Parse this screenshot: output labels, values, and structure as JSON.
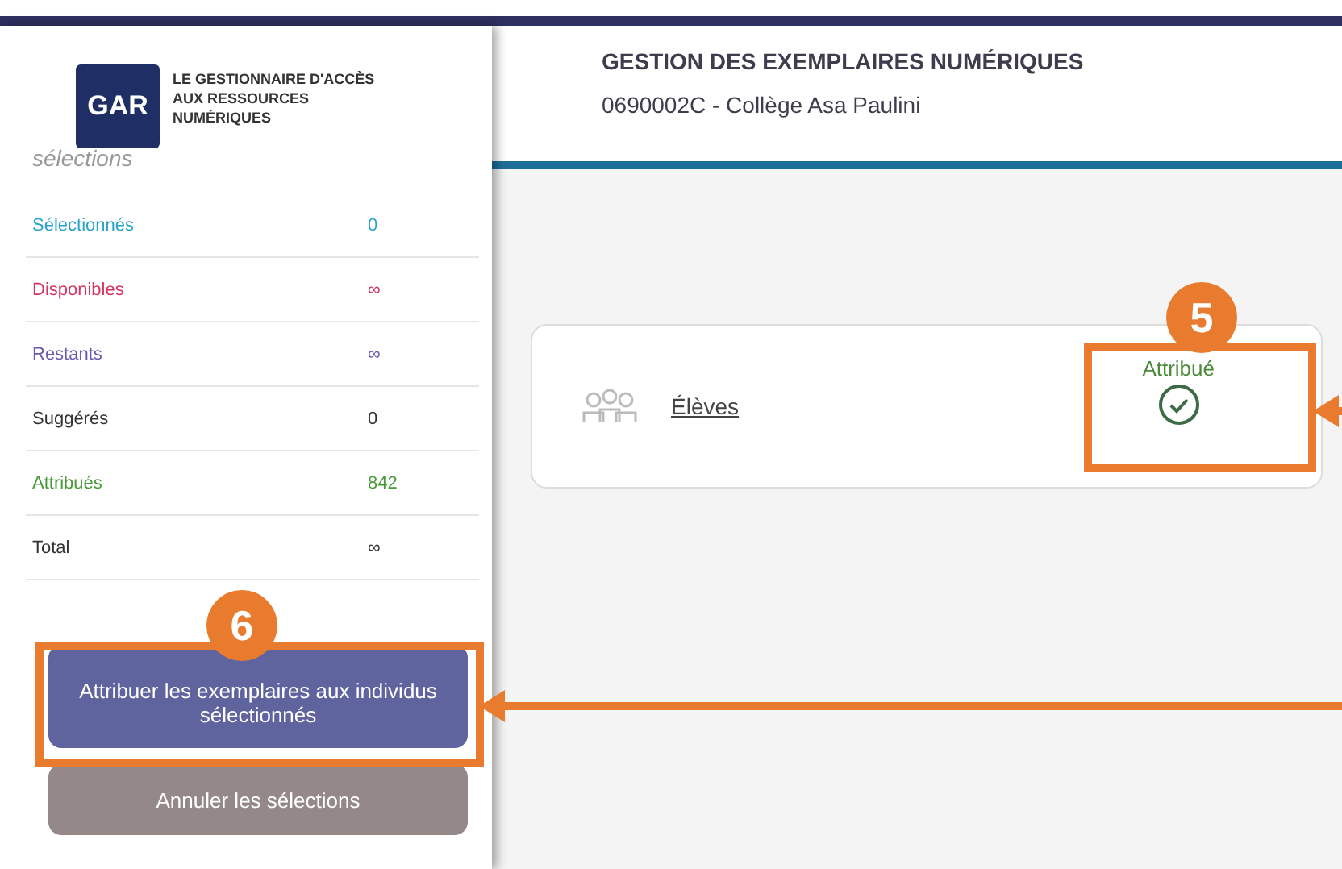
{
  "logo": {
    "mark": "GAR",
    "tagline": "LE GESTIONNAIRE D'ACCÈS AUX RESSOURCES NUMÉRIQUES"
  },
  "header": {
    "title": "GESTION DES EXEMPLAIRES NUMÉRIQUES",
    "subtitle": "0690002C - Collège Asa Paulini"
  },
  "sidebar": {
    "heading": "sélections",
    "stats": [
      {
        "label": "Sélectionnés",
        "value": "0",
        "color": "#2aa3c8"
      },
      {
        "label": "Disponibles",
        "value": "∞",
        "color": "#d6335e"
      },
      {
        "label": "Restants",
        "value": "∞",
        "color": "#6b5bb0"
      },
      {
        "label": "Suggérés",
        "value": "0",
        "color": "#333333"
      },
      {
        "label": "Attribués",
        "value": "842",
        "color": "#4a9a3a"
      },
      {
        "label": "Total",
        "value": "∞",
        "color": "#333333"
      }
    ],
    "buttons": [
      {
        "label": "Attribuer les exemplaires aux individus sélectionnés",
        "kind": "primary"
      },
      {
        "label": "Annuler les sélections",
        "kind": "secondary"
      }
    ]
  },
  "group": {
    "label": "Élèves",
    "status": "Attribué"
  },
  "callouts": [
    {
      "number": "5",
      "kind": "status"
    },
    {
      "number": "6",
      "kind": "assign"
    }
  ]
}
